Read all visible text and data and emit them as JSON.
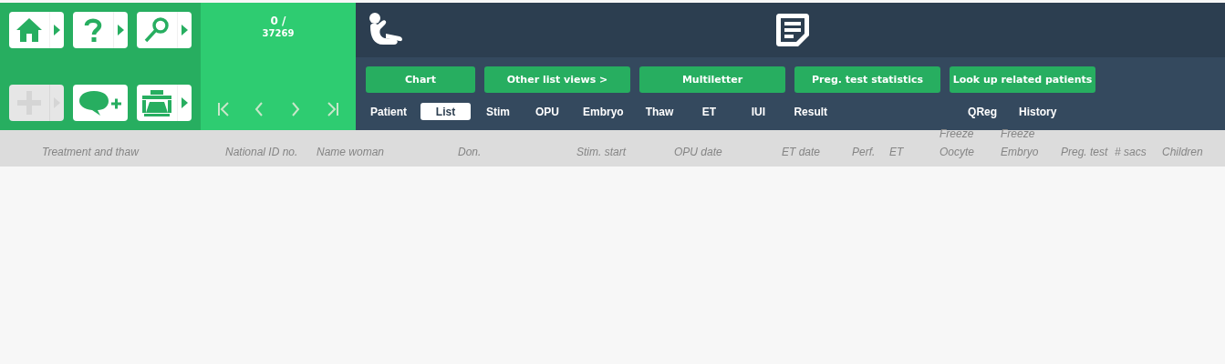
{
  "tool_buttons": [
    {
      "kind": "home",
      "disabled": false,
      "has_menu": true
    },
    {
      "kind": "help",
      "disabled": false,
      "has_menu": true
    },
    {
      "kind": "search",
      "disabled": false,
      "has_menu": true
    },
    {
      "kind": "add",
      "disabled": true,
      "has_menu": true
    },
    {
      "kind": "comment",
      "disabled": false,
      "has_menu": false
    },
    {
      "kind": "print",
      "disabled": false,
      "has_menu": true
    }
  ],
  "counter": {
    "position": "0 /",
    "total": "37269"
  },
  "actions": [
    "Chart",
    "Other list views >",
    "Multiletter",
    "Preg. test statistics",
    "Look up related patients"
  ],
  "tabs": [
    {
      "label": "Patient",
      "selected": false
    },
    {
      "label": "List",
      "selected": true
    },
    {
      "label": "Stim",
      "selected": false
    },
    {
      "label": "OPU",
      "selected": false
    },
    {
      "label": "Embryo",
      "selected": false
    },
    {
      "label": "Thaw",
      "selected": false
    },
    {
      "label": "ET",
      "selected": false
    },
    {
      "label": "IUI",
      "selected": false
    },
    {
      "label": "Result",
      "selected": false
    }
  ],
  "side_tabs": [
    {
      "label": "QReg",
      "selected": false
    },
    {
      "label": "History",
      "selected": false
    }
  ],
  "table": {
    "columns": [
      "Treatment and thaw",
      "National ID no.",
      "Name woman",
      "Don.",
      "Stim. start",
      "OPU date",
      "ET date",
      "Perf.",
      "ET",
      "Freeze\nOocyte",
      "Freeze\nEmbryo",
      "Preg. test",
      "# sacs",
      "Children"
    ]
  }
}
